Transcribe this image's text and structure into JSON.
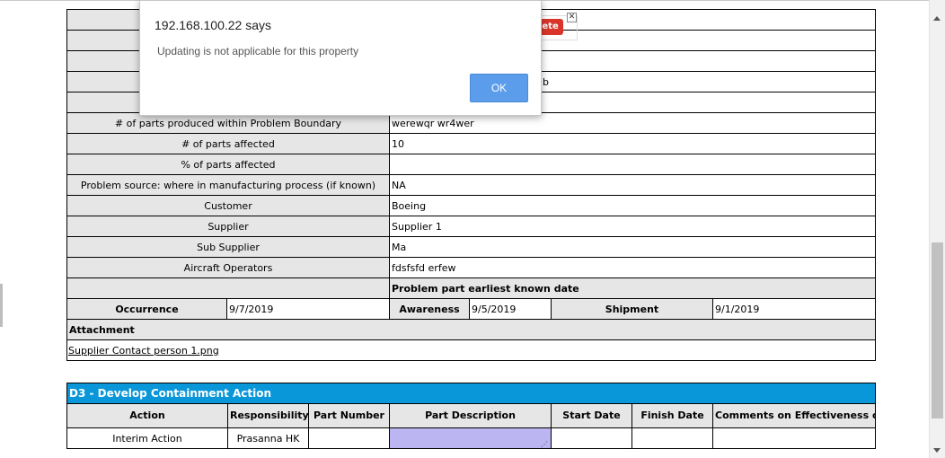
{
  "dialog": {
    "title": "192.168.100.22 says",
    "message": "Updating is not applicable for this property",
    "ok_label": "OK"
  },
  "behind": {
    "delete_fragment": "lete",
    "close_glyph": "✕",
    "partial_value": "b"
  },
  "details": {
    "rows": [
      {
        "label": "# of parts produced within Problem Boundary",
        "value": "werewqr wr4wer"
      },
      {
        "label": "# of parts affected",
        "value": "10"
      },
      {
        "label": "% of parts affected",
        "value": ""
      },
      {
        "label": "Problem source: where in manufacturing process (if known)",
        "value": "NA"
      },
      {
        "label": "Customer",
        "value": "Boeing"
      },
      {
        "label": "Supplier",
        "value": "Supplier 1"
      },
      {
        "label": "Sub Supplier",
        "value": "Ma"
      },
      {
        "label": "Aircraft Operators",
        "value": "fdsfsfd erfew"
      }
    ],
    "earliest_date_header": "Problem part earliest known date"
  },
  "dates": {
    "occurrence_label": "Occurrence",
    "occurrence_value": "9/7/2019",
    "awareness_label": "Awareness",
    "awareness_value": "9/5/2019",
    "shipment_label": "Shipment",
    "shipment_value": "9/1/2019"
  },
  "attachment": {
    "label": "Attachment",
    "file": "Supplier Contact person 1.png"
  },
  "d3": {
    "title": "D3 - Develop Containment Action",
    "columns": [
      "Action",
      "Responsibility",
      "Part Number",
      "Part Description",
      "Start Date",
      "Finish Date",
      "Comments on Effectiveness of Containment Actions"
    ],
    "row": {
      "action": "Interim Action",
      "responsibility": "Prasanna HK",
      "part_number": "",
      "part_description": "",
      "start_date": "",
      "finish_date": "",
      "comments": ""
    }
  },
  "colors": {
    "section_bar": "#0a97d9",
    "label_bg": "#e6e6e6",
    "ok_button": "#5b9dea",
    "part_desc_bg": "#bbb5f2",
    "delete_button": "#d9352a"
  },
  "icons": {
    "resize": "resize-grip-icon",
    "scroll_up": "chevron-up-icon",
    "scroll_down": "chevron-down-icon"
  }
}
